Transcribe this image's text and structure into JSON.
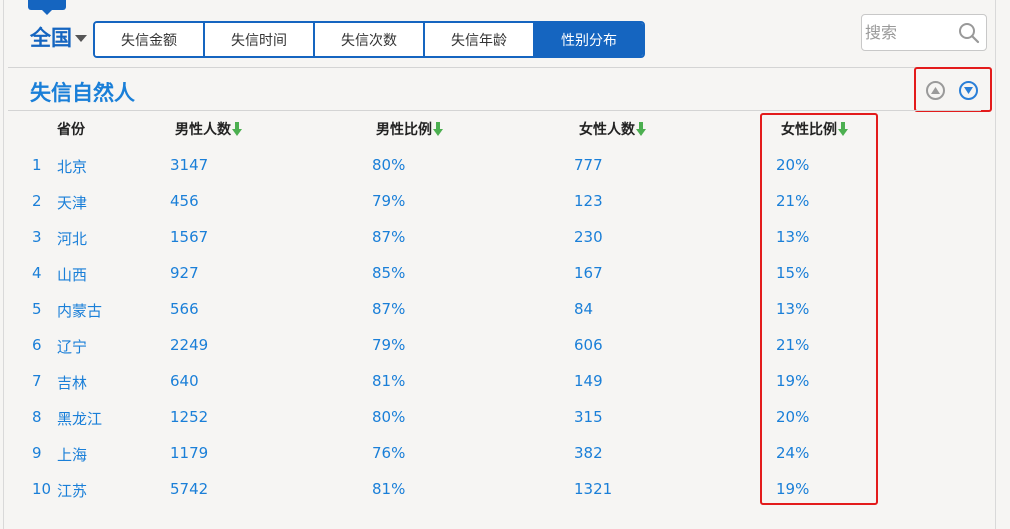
{
  "region": {
    "label": "全国"
  },
  "tabs": [
    {
      "label": "失信金额",
      "active": false
    },
    {
      "label": "失信时间",
      "active": false
    },
    {
      "label": "失信次数",
      "active": false
    },
    {
      "label": "失信年龄",
      "active": false
    },
    {
      "label": "性别分布",
      "active": true
    }
  ],
  "search": {
    "placeholder": "搜索"
  },
  "section": {
    "title": "失信自然人"
  },
  "table": {
    "headers": [
      "省份",
      "男性人数",
      "男性比例",
      "女性人数",
      "女性比例"
    ],
    "rows": [
      {
        "rank": "1",
        "province": "北京",
        "male_count": "3147",
        "male_ratio": "80%",
        "female_count": "777",
        "female_ratio": "20%"
      },
      {
        "rank": "2",
        "province": "天津",
        "male_count": "456",
        "male_ratio": "79%",
        "female_count": "123",
        "female_ratio": "21%"
      },
      {
        "rank": "3",
        "province": "河北",
        "male_count": "1567",
        "male_ratio": "87%",
        "female_count": "230",
        "female_ratio": "13%"
      },
      {
        "rank": "4",
        "province": "山西",
        "male_count": "927",
        "male_ratio": "85%",
        "female_count": "167",
        "female_ratio": "15%"
      },
      {
        "rank": "5",
        "province": "内蒙古",
        "male_count": "566",
        "male_ratio": "87%",
        "female_count": "84",
        "female_ratio": "13%"
      },
      {
        "rank": "6",
        "province": "辽宁",
        "male_count": "2249",
        "male_ratio": "79%",
        "female_count": "606",
        "female_ratio": "21%"
      },
      {
        "rank": "7",
        "province": "吉林",
        "male_count": "640",
        "male_ratio": "81%",
        "female_count": "149",
        "female_ratio": "19%"
      },
      {
        "rank": "8",
        "province": "黑龙江",
        "male_count": "1252",
        "male_ratio": "80%",
        "female_count": "315",
        "female_ratio": "20%"
      },
      {
        "rank": "9",
        "province": "上海",
        "male_count": "1179",
        "male_ratio": "76%",
        "female_count": "382",
        "female_ratio": "24%"
      },
      {
        "rank": "10",
        "province": "江苏",
        "male_count": "5742",
        "male_ratio": "81%",
        "female_count": "1321",
        "female_ratio": "19%"
      }
    ]
  },
  "icons": {
    "scroll_up": "chevron-up-circle-icon",
    "scroll_down": "chevron-down-circle-icon",
    "search": "search-icon",
    "sort": "sort-down-arrow-icon"
  },
  "colors": {
    "brand_blue": "#1565c0",
    "link_blue": "#1a7fd8",
    "highlight_red": "#e31b1b",
    "sort_green": "#4caf50"
  }
}
